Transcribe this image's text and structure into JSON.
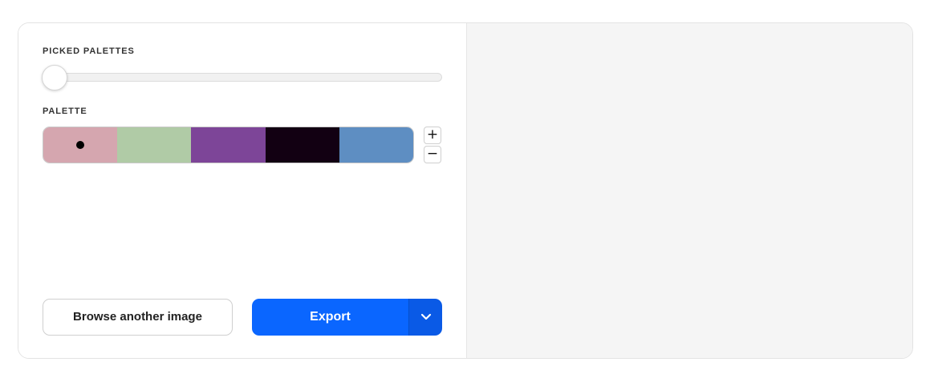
{
  "labels": {
    "picked_palettes": "PICKED PALETTES",
    "palette": "PALETTE"
  },
  "slider": {
    "value": 0.0
  },
  "palette": {
    "selected_index": 0,
    "swatches": [
      "#d5a6af",
      "#b0cba6",
      "#7d4598",
      "#120012",
      "#5e8ec2"
    ]
  },
  "stepper": {
    "plus": "+",
    "minus": "−"
  },
  "buttons": {
    "browse": "Browse another image",
    "export": "Export"
  },
  "icons": {
    "export_menu": "chevron-down-icon"
  },
  "colors": {
    "accent": "#0a66ff",
    "picked_color": "#d5a6af",
    "background_purple": "#5b2aa7"
  }
}
